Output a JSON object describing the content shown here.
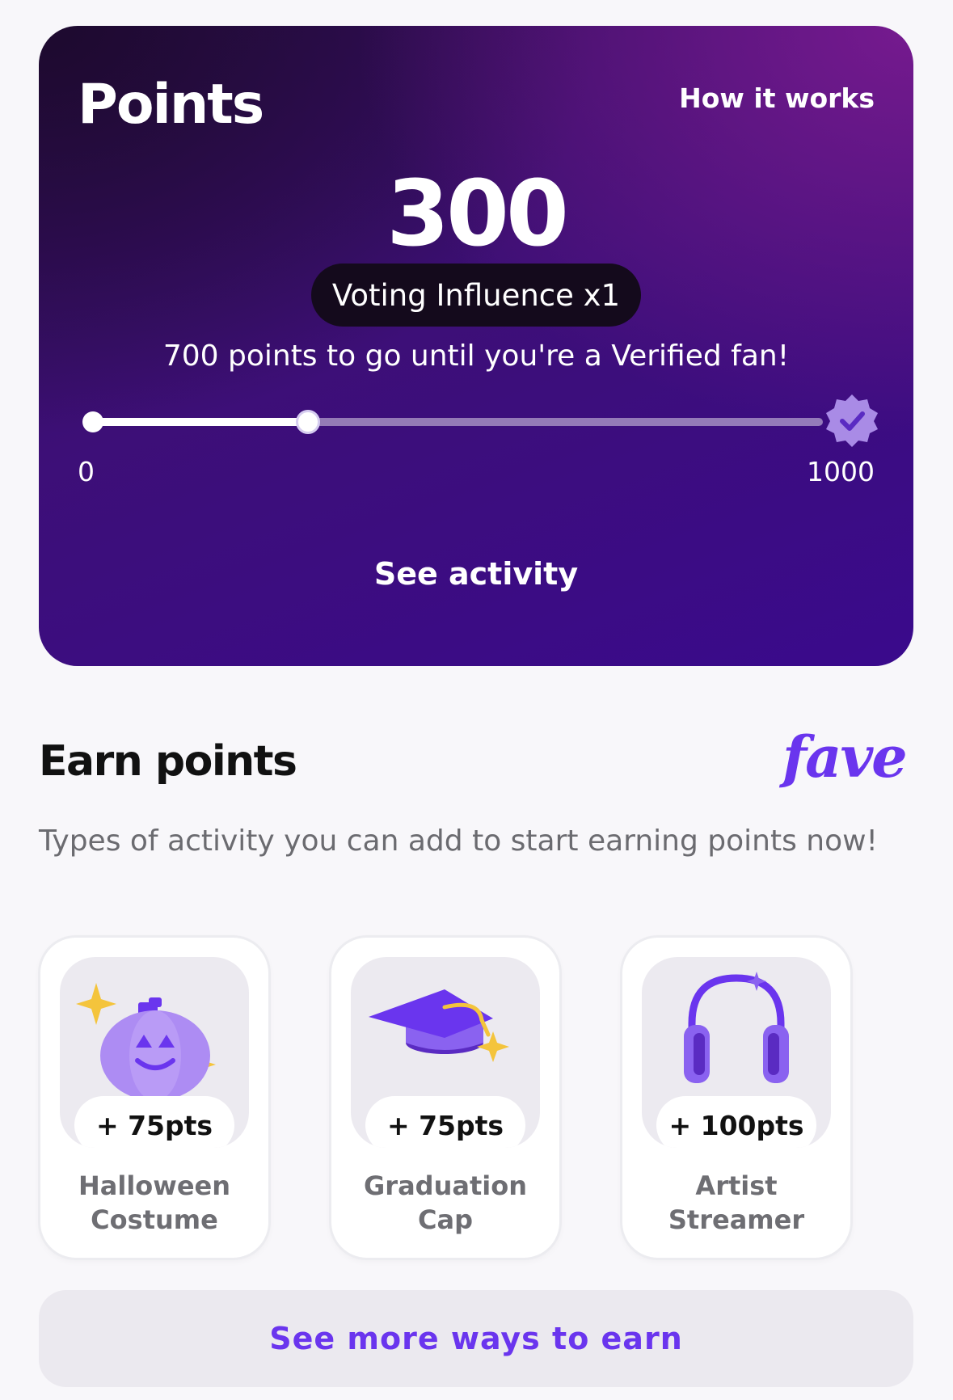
{
  "points_card": {
    "title": "Points",
    "how_it_works_label": "How it works",
    "points": "300",
    "influence_label": "Voting Influence x1",
    "goal_text": "700 points to go until you're a Verified fan!",
    "progress": {
      "current": 300,
      "min": 0,
      "max": 1000
    },
    "range_min_label": "0",
    "range_max_label": "1000",
    "verified_icon": "verified-badge-icon",
    "see_activity_label": "See activity"
  },
  "earn": {
    "title": "Earn points",
    "brand_logo": "fave",
    "description": "Types of activity you can add to start earning points now!",
    "items": [
      {
        "icon": "pumpkin-icon",
        "points_label": "+ 75pts",
        "label": "Halloween\nCostume"
      },
      {
        "icon": "graduation-cap-icon",
        "points_label": "+ 75pts",
        "label": "Graduation\nCap"
      },
      {
        "icon": "headphones-icon",
        "points_label": "+ 100pts",
        "label": "Artist\nStreamer"
      }
    ],
    "more_label": "See more ways to earn"
  },
  "colors": {
    "accent": "#6a35ee",
    "card_gradient_start": "#1d0a2e",
    "card_gradient_end": "#3a0a8c",
    "sparkle": "#f4c43c"
  }
}
